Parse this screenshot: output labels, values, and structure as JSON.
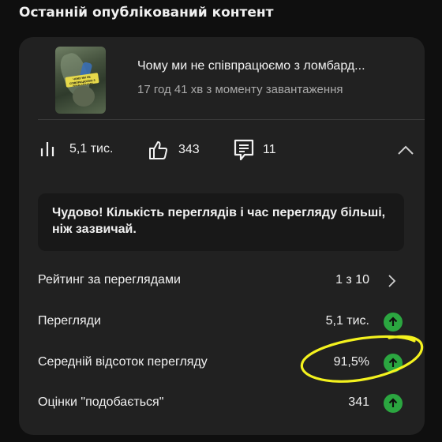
{
  "section": {
    "title": "Останній опублікований контент"
  },
  "video": {
    "title": "Чому ми не співпрацюємо з ломбард...",
    "meta": "17 год 41 хв з моменту завантаження",
    "thumbnail_tag": "ЧОМУ МИ НЕ СПІВПРАЦЮЄМО З ЛОМБАРДАМИ"
  },
  "stats": {
    "views": "5,1 тис.",
    "likes": "343",
    "comments": "11"
  },
  "insight": {
    "text": "Чудово! Кількість переглядів і час перегляду більші, ніж зазвичай."
  },
  "metrics": [
    {
      "label": "Рейтинг за переглядами",
      "value": "1 з 10",
      "indicator": "chevron-right"
    },
    {
      "label": "Перегляди",
      "value": "5,1 тис.",
      "indicator": "up-arrow"
    },
    {
      "label": "Середній відсоток перегляду",
      "value": "91,5%",
      "indicator": "up-arrow"
    },
    {
      "label": "Оцінки \"подобається\"",
      "value": "341",
      "indicator": "up-arrow"
    }
  ],
  "colors": {
    "background": "#0f0f0f",
    "card": "#212121",
    "insight_box": "#181818",
    "positive_badge": "#2ba640",
    "highlight_annotation": "#f4f21e"
  }
}
